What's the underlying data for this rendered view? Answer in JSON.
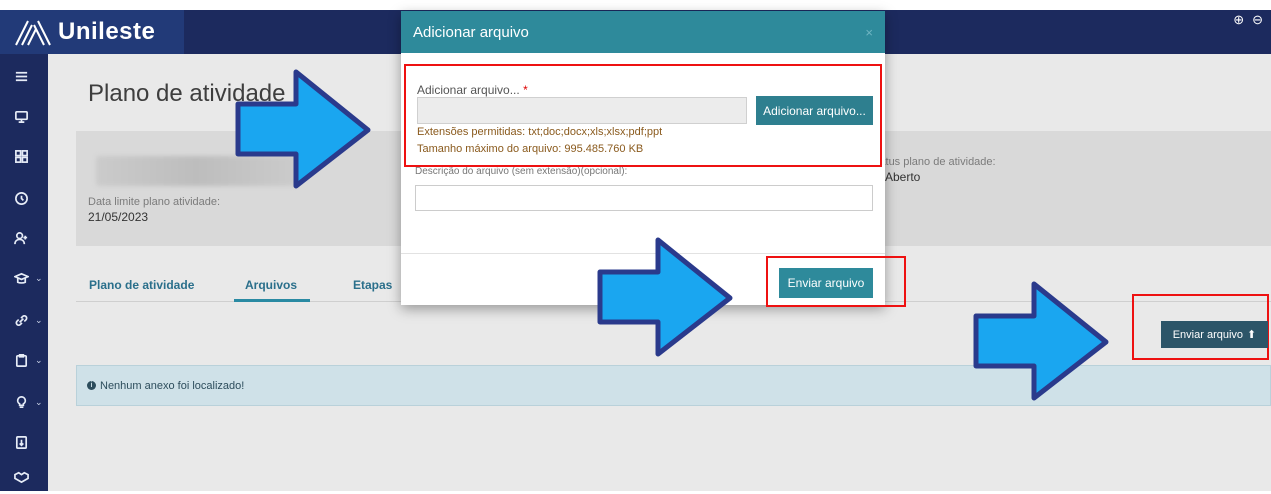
{
  "app": {
    "brand": "Unileste"
  },
  "page": {
    "title": "Plano de atividade"
  },
  "info": {
    "deadline_label": "Data limite plano atividade:",
    "deadline_value": "21/05/2023",
    "status_label": "Status plano de atividade:",
    "status_value": "Aberto"
  },
  "tabs": [
    {
      "label": "Plano de atividade"
    },
    {
      "label": "Arquivos",
      "active": true
    },
    {
      "label": "Etapas"
    }
  ],
  "actions": {
    "send_file": "Enviar arquivo"
  },
  "alert": {
    "message": "Nenhum anexo foi localizado!"
  },
  "modal": {
    "title": "Adicionar arquivo",
    "close": "×",
    "field_label": "Adicionar arquivo...",
    "required_mark": "*",
    "add_button": "Adicionar arquivo...",
    "help_extensions": "Extensões permitidas: txt;doc;docx;xls;xlsx;pdf;ppt",
    "help_max_size": "Tamanho máximo do arquivo: 995.485.760 KB",
    "description_label": "Descrição do arquivo (sem extensão)(opcional):",
    "description_value": "",
    "submit": "Enviar arquivo"
  },
  "sidebar": {
    "items": [
      {
        "icon": "menu-icon"
      },
      {
        "icon": "monitor-icon"
      },
      {
        "icon": "grid-icon"
      },
      {
        "icon": "clock-icon"
      },
      {
        "icon": "add-user-icon"
      },
      {
        "icon": "graduation-cap-icon",
        "has_chevron": true
      },
      {
        "icon": "link-icon",
        "has_chevron": true
      },
      {
        "icon": "clipboard-icon",
        "has_chevron": true
      },
      {
        "icon": "lightbulb-icon",
        "has_chevron": true
      },
      {
        "icon": "document-icon"
      },
      {
        "icon": "handshake-icon"
      }
    ]
  },
  "colors": {
    "header": "#1c2a5e",
    "modal_header": "#2e8a9b",
    "button": "#2e7f8f",
    "highlight_border": "#e11111",
    "arrow_fill": "#1aa6f0",
    "arrow_outline": "#2a3a8c"
  }
}
